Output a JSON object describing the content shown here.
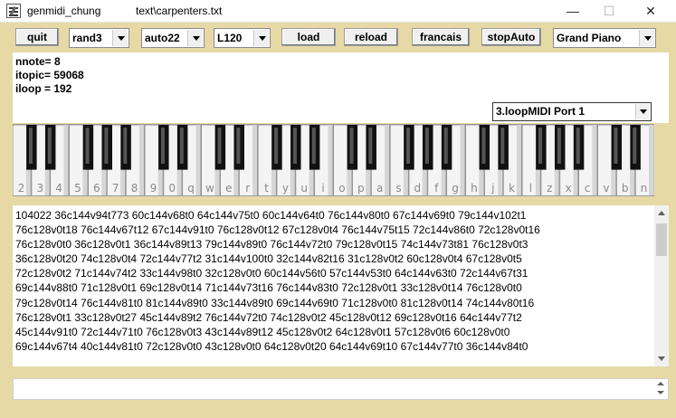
{
  "window": {
    "app_title": "genmidi_chung",
    "file_title": "text\\carpenters.txt",
    "controls": {
      "minimize": "—",
      "maximize": "☐",
      "close": "✕"
    }
  },
  "toolbar": {
    "quit_label": "quit",
    "mode_select": "rand3",
    "auto_select": "auto22",
    "length_select": "L120",
    "load_label": "load",
    "reload_label": "reload",
    "francais_label": "francais",
    "stopauto_label": "stopAuto",
    "instrument_select": "Grand Piano"
  },
  "info": {
    "nnote": "nnote= 8",
    "itopic": "itopic= 59068",
    "iloop": "iloop = 192"
  },
  "midi_port": "3.loopMIDI Port 1",
  "piano": {
    "key_labels": [
      "2",
      "3",
      "4",
      "5",
      "6",
      "7",
      "8",
      "9",
      "0",
      "q",
      "w",
      "e",
      "r",
      "t",
      "y",
      "u",
      "i",
      "o",
      "p",
      "a",
      "s",
      "d",
      "f",
      "g",
      "h",
      "j",
      "k",
      "l",
      "z",
      "x",
      "c",
      "v",
      "b",
      "n"
    ],
    "black_after": [
      0,
      1,
      3,
      4,
      5,
      7,
      8,
      10,
      11,
      13,
      14,
      15,
      17,
      18,
      20,
      21,
      22,
      24,
      25,
      27,
      28,
      29,
      31,
      32
    ]
  },
  "text_lines": [
    "104022 36c144v94t773 60c144v68t0 64c144v75t0 60c144v64t0 76c144v80t0 67c144v69t0 79c144v102t1",
    "76c128v0t18 76c144v67t12 67c144v91t0 76c128v0t12 67c128v0t4 76c144v75t15 72c144v86t0 72c128v0t16",
    "76c128v0t0 36c128v0t1 36c144v89t13 79c144v89t0 76c144v72t0 79c128v0t15 74c144v73t81 76c128v0t3",
    "36c128v0t20 74c128v0t4 72c144v77t2 31c144v100t0 32c144v82t16 31c128v0t2 60c128v0t4 67c128v0t5",
    "72c128v0t2 71c144v74t2 33c144v98t0 32c128v0t0 60c144v56t0 57c144v53t0 64c144v63t0 72c144v67t31",
    "69c144v88t0 71c128v0t1 69c128v0t14 71c144v73t16 76c144v83t0 72c128v0t1 33c128v0t14 76c128v0t0",
    "79c128v0t14 76c144v81t0 81c144v89t0 33c144v89t0 69c144v69t0 71c128v0t0 81c128v0t14 74c144v80t16",
    "76c128v0t1 33c128v0t27 45c144v89t2 76c144v72t0 74c128v0t2 45c128v0t12 69c128v0t16 64c144v77t2",
    "45c144v91t0 72c144v71t0 76c128v0t3 43c144v89t12 45c128v0t2 64c128v0t1 57c128v0t6 60c128v0t0",
    "69c144v67t4 40c144v81t0 72c128v0t0 43c128v0t0 64c128v0t20 64c144v69t10 67c144v77t0 36c144v84t0"
  ]
}
